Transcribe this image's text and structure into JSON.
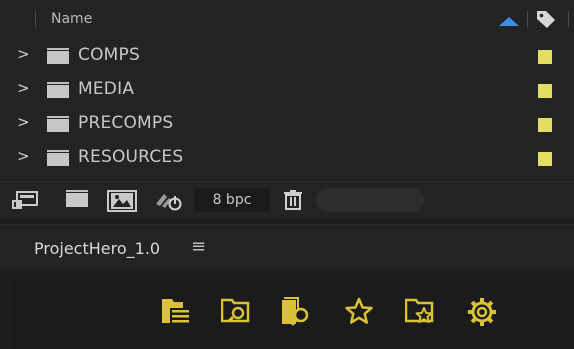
{
  "header": {
    "column_name": "Name"
  },
  "rows": [
    {
      "label": "COMPS"
    },
    {
      "label": "MEDIA"
    },
    {
      "label": "PRECOMPS"
    },
    {
      "label": "RESOURCES"
    }
  ],
  "toolbar": {
    "bpc_label": "8 bpc"
  },
  "project_panel": {
    "title": "ProjectHero_1.0",
    "menu_glyph": "≡"
  },
  "colors": {
    "label_swatch": "#e3dd61",
    "sort_arrow": "#3b8fe6",
    "hero_icon": "#d9c238"
  },
  "icons": {
    "hero_buttons": [
      "folder-list-icon",
      "folder-search-icon",
      "file-search-icon",
      "star-icon",
      "folder-star-icon",
      "gear-icon"
    ]
  }
}
